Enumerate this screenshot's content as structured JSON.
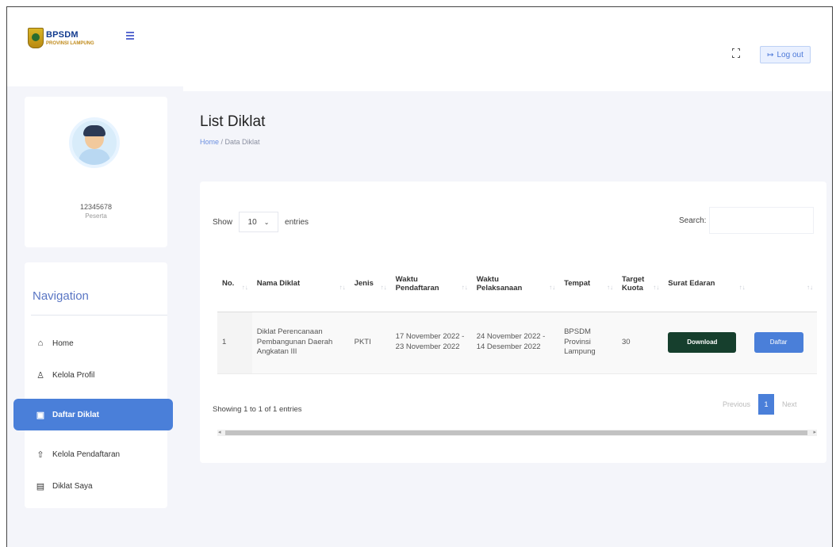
{
  "app": {
    "logo_title": "BPSDM",
    "logo_subtitle": "PROVINSI LAMPUNG",
    "accent": "#4a7fd9",
    "dark_green": "#163f2d"
  },
  "header": {
    "logout_label": "Log out",
    "fullscreen_icon": "fullscreen-icon",
    "logout_icon": "logout-icon"
  },
  "user": {
    "id": "12345678",
    "role": "Peserta"
  },
  "nav": {
    "title": "Navigation",
    "items": [
      {
        "label": "Home",
        "icon": "home-icon"
      },
      {
        "label": "Kelola Profil",
        "icon": "user-icon"
      },
      {
        "label": "Daftar Diklat",
        "icon": "clipboard-icon",
        "active": true
      },
      {
        "label": "Kelola Pendaftaran",
        "icon": "upload-icon"
      },
      {
        "label": "Diklat Saya",
        "icon": "calendar-icon"
      }
    ]
  },
  "page": {
    "title": "List Diklat",
    "breadcrumb_home": "Home",
    "breadcrumb_sep": " / ",
    "breadcrumb_current": "Data Diklat"
  },
  "table_controls": {
    "show_label": "Show",
    "entries_value": "10",
    "entries_label": "entries",
    "search_label": "Search:",
    "search_placeholder": ""
  },
  "table": {
    "headers": [
      "No.",
      "Nama Diklat",
      "Jenis",
      "Waktu Pendaftaran",
      "Waktu Pelaksanaan",
      "Tempat",
      "Target Kuota",
      "Surat Edaran",
      ""
    ],
    "rows": [
      {
        "no": "1",
        "nama": "Diklat Perencanaan Pembangunan Daerah Angkatan III",
        "jenis": "PKTI",
        "pendaftaran": "17 November 2022 - 23 November 2022",
        "pelaksanaan": "24 November 2022 - 14 Desember 2022",
        "tempat": "BPSDM Provinsi Lampung",
        "kuota": "30",
        "download_label": "Download",
        "daftar_label": "Daftar"
      }
    ]
  },
  "footer": {
    "info": "Showing 1 to 1 of 1 entries",
    "prev": "Previous",
    "page": "1",
    "next": "Next"
  }
}
